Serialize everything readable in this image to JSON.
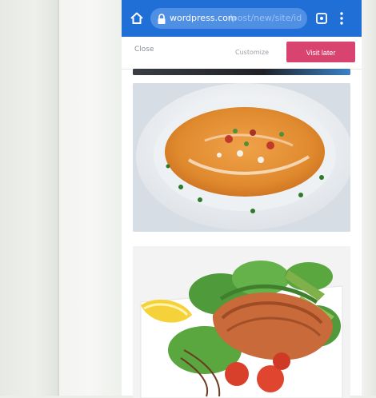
{
  "browser": {
    "url_host": "wordpress.com",
    "url_path": "/post/new/site/id",
    "home_icon": "home-icon",
    "lock_icon": "lock-icon",
    "tabs_icon": "tabs-icon",
    "menu_icon": "overflow-menu-icon",
    "bar_color": "#1f6fd6"
  },
  "banner": {
    "left_text": "Close",
    "mid_text": "Customize",
    "visit_button": "Visit later",
    "accent_color": "#d9436f"
  },
  "feed": {
    "items": [
      {
        "kind": "image",
        "subject": "partial dish photo"
      },
      {
        "kind": "image",
        "subject": "orange soup in white bowl"
      },
      {
        "kind": "image",
        "subject": "grilled salmon with lettuce, lemon and tomatoes"
      }
    ]
  }
}
